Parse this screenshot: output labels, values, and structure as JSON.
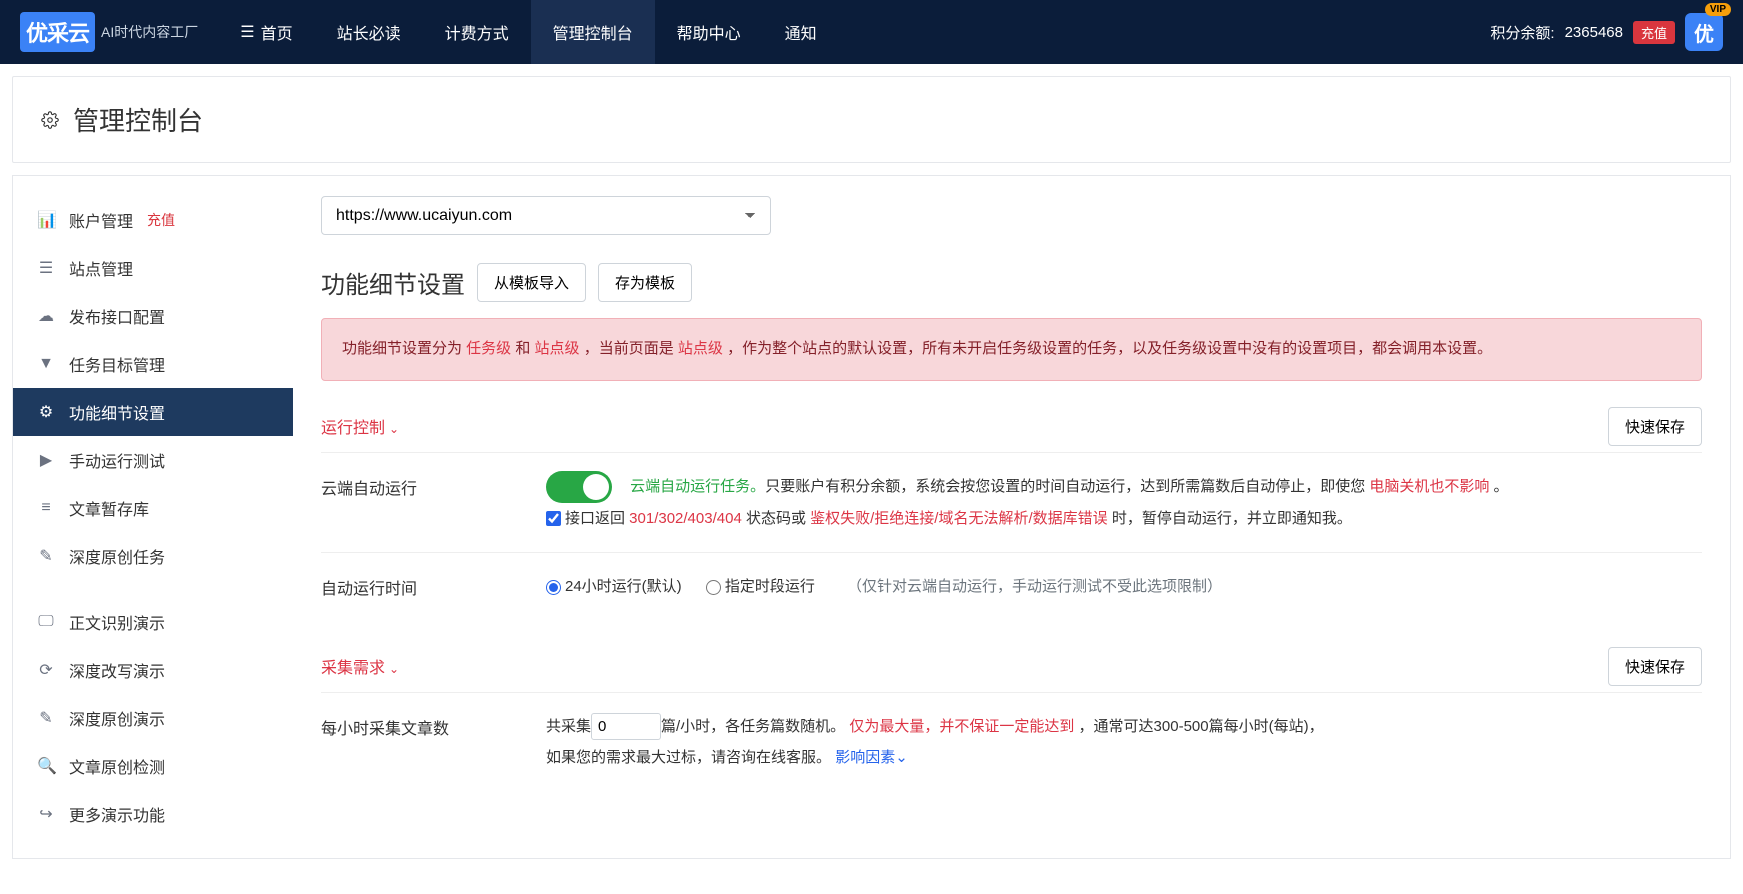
{
  "brand": {
    "logo": "优采云",
    "sub": "AI时代内容工厂"
  },
  "nav": {
    "items": [
      {
        "label": "首页"
      },
      {
        "label": "站长必读"
      },
      {
        "label": "计费方式"
      },
      {
        "label": "管理控制台"
      },
      {
        "label": "帮助中心"
      },
      {
        "label": "通知"
      }
    ],
    "points_label": "积分余额:",
    "points_value": "2365468",
    "recharge": "充值",
    "vip": "VIP",
    "avatar_text": "优"
  },
  "page_title": "管理控制台",
  "sidebar": {
    "items": [
      {
        "label": "账户管理",
        "badge": "充值"
      },
      {
        "label": "站点管理"
      },
      {
        "label": "发布接口配置"
      },
      {
        "label": "任务目标管理"
      },
      {
        "label": "功能细节设置"
      },
      {
        "label": "手动运行测试"
      },
      {
        "label": "文章暂存库"
      },
      {
        "label": "深度原创任务"
      }
    ],
    "items2": [
      {
        "label": "正文识别演示"
      },
      {
        "label": "深度改写演示"
      },
      {
        "label": "深度原创演示"
      },
      {
        "label": "文章原创检测"
      },
      {
        "label": "更多演示功能"
      }
    ]
  },
  "site_select": "https://www.ucaiyun.com",
  "sec_title": "功能细节设置",
  "btn_import": "从模板导入",
  "btn_save_tpl": "存为模板",
  "alert": {
    "p1a": "功能细节设置分为 ",
    "p1b": "任务级",
    "p1c": " 和 ",
    "p1d": "站点级",
    "p1e": " ，当前页面是 ",
    "p1f": "站点级",
    "p1g": " ，作为整个站点的默认设置，所有未开启任务级设置的任务，以及任务级设置中没有的设置项目，都会调用本设置。"
  },
  "panel1": {
    "title": "运行控制",
    "quick_save": "快速保存"
  },
  "row_auto": {
    "label": "云端自动运行",
    "green": "云端自动运行任务。",
    "t1": "只要账户有积分余额，系统会按您设置的时间自动运行，达到所需篇数后自动停止，即使您 ",
    "red1": "电脑关机也不影响",
    "t2": " 。",
    "t3": "接口返回 ",
    "red2": "301/302/403/404",
    "t4": " 状态码或 ",
    "red3": "鉴权失败/拒绝连接/域名无法解析/数据库错误",
    "t5": " 时，暂停自动运行，并立即通知我。"
  },
  "row_time": {
    "label": "自动运行时间",
    "opt1": "24小时运行(默认)",
    "opt2": "指定时段运行",
    "hint": "（仅针对云端自动运行，手动运行测试不受此选项限制）"
  },
  "panel2": {
    "title": "采集需求",
    "quick_save": "快速保存"
  },
  "row_count": {
    "label": "每小时采集文章数",
    "t1": "共采集",
    "value": "0",
    "t2": "篇/小时，各任务篇数随机。 ",
    "red": "仅为最大量，并不保证一定能达到",
    "t3": " ，通常可达300-500篇每小时(每站)，",
    "t4": "如果您的需求最大过标，请咨询在线客服。",
    "blue": "影响因素"
  }
}
